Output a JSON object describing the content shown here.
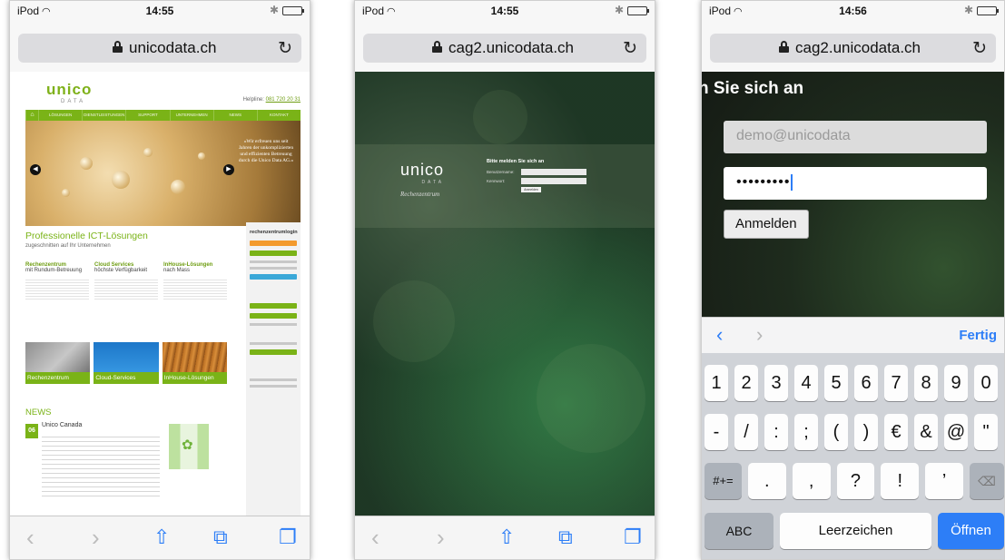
{
  "screens": [
    {
      "status": {
        "carrier": "iPod",
        "time": "14:55"
      },
      "url": "unicodata.ch",
      "site": {
        "logo_top": "unico",
        "logo_bottom": "DATA",
        "hotline_label": "Helpline:",
        "hotline_number": "081 720 20 31",
        "nav": [
          "LÖSUNGEN",
          "DIENSTLEISTUNGEN",
          "SUPPORT",
          "UNTERNEHMEN",
          "NEWS",
          "KONTAKT"
        ],
        "hero_quote": "«Wir erfreuen uns seit Jahren der unkomplizierten und effizienten Betreuung durch die Unico Data AG.»",
        "intro_title": "Professionelle ICT-Lösungen",
        "intro_subtitle": "zugeschnitten auf Ihr Unternehmen",
        "columns": [
          {
            "title": "Rechenzentrum",
            "subtitle": "mit Rundum-Betreuung"
          },
          {
            "title": "Cloud Services",
            "subtitle": "höchste Verfügbarkeit"
          },
          {
            "title": "InHouse-Lösungen",
            "subtitle": "nach Mass"
          }
        ],
        "tiles": [
          "Rechenzentrum",
          "Cloud-Services",
          "InHouse-Lösungen"
        ],
        "news_heading": "NEWS",
        "news_day": "06",
        "news_title": "Unico Canada",
        "sidebar_title": "rechenzentrumlogin"
      }
    },
    {
      "status": {
        "carrier": "iPod",
        "time": "14:55"
      },
      "url": "cag2.unicodata.ch",
      "login": {
        "logo_top": "unico",
        "logo_bottom": "DATA",
        "logo_sub": "Rechenzentrum",
        "form_title": "Bitte melden Sie sich an",
        "user_label": "Benutzername:",
        "pass_label": "Kennwort:",
        "submit": "Anmelden"
      }
    },
    {
      "status": {
        "carrier": "iPod",
        "time": "14:56"
      },
      "url": "cag2.unicodata.ch",
      "login": {
        "title": "n Sie sich an",
        "username_value": "demo@unicodata",
        "password_value": "•••••••••",
        "submit": "Anmelden"
      },
      "accessory": {
        "done": "Fertig"
      },
      "keyboard": {
        "row1": [
          "1",
          "2",
          "3",
          "4",
          "5",
          "6",
          "7",
          "8",
          "9",
          "0"
        ],
        "row2": [
          "-",
          "/",
          ":",
          ";",
          "(",
          ")",
          "€",
          "&",
          "@",
          "\""
        ],
        "row3_mod": "#+=",
        "row3": [
          ".",
          ",",
          "?",
          "!",
          "’"
        ],
        "abc": "ABC",
        "space": "Leerzeichen",
        "go": "Öffnen"
      }
    }
  ]
}
